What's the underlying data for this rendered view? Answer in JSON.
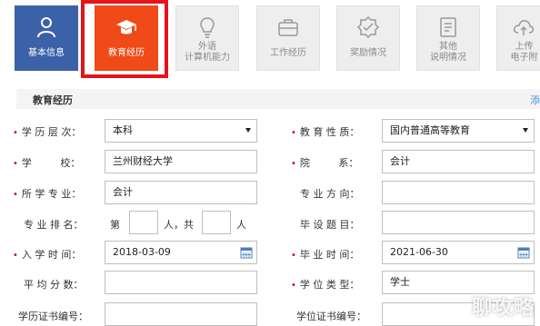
{
  "tabs": [
    {
      "label": "基本信息",
      "icon": "user-icon"
    },
    {
      "label": "教育经历",
      "icon": "graduation-cap-icon"
    },
    {
      "label_line1": "外语",
      "label_line2": "计算机能力",
      "icon": "lightbulb-icon"
    },
    {
      "label": "工作经历",
      "icon": "briefcase-icon"
    },
    {
      "label": "奖励情况",
      "icon": "award-icon"
    },
    {
      "label_line1": "其他",
      "label_line2": "说明情况",
      "icon": "document-icon"
    },
    {
      "label_line1": "上传",
      "label_line2": "电子附",
      "icon": "cloud-upload-icon"
    }
  ],
  "section": {
    "title": "教育经历",
    "link": "添"
  },
  "form": {
    "degree_level": {
      "label": "学 历 层 次：",
      "value": "本科"
    },
    "edu_nature": {
      "label": "教 育 性 质：",
      "value": "国内普通高等教育"
    },
    "school": {
      "label": "学         校：",
      "value": "兰州财经大学"
    },
    "department": {
      "label": "院         系：",
      "value": "会计"
    },
    "major": {
      "label": "所 学 专 业：",
      "value": "会计"
    },
    "major_direction": {
      "label": "专 业 方 向：",
      "value": ""
    },
    "major_rank": {
      "label": "专 业 排 名：",
      "prefix": "第",
      "middle": "人，共",
      "suffix": "人"
    },
    "thesis_title": {
      "label": "毕 设 题 目：",
      "value": ""
    },
    "enroll_date": {
      "label": "入 学 时 间：",
      "value": "2018-03-09"
    },
    "grad_date": {
      "label": "毕 业 时 间：",
      "value": "2021-06-30"
    },
    "gpa": {
      "label": "平 均 分 数：",
      "value": ""
    },
    "degree_type": {
      "label": "学 位 类 型：",
      "value": "学士"
    },
    "diploma_no": {
      "label": "学历证书编号：",
      "value": ""
    },
    "degree_cert_no": {
      "label": "学位证书编号：",
      "value": ""
    }
  },
  "watermark": "聊攻略",
  "colors": {
    "active_blue": "#3b62a8",
    "active_orange": "#ef4a17",
    "highlight_red": "#e3141b",
    "required": "#d0021b"
  }
}
